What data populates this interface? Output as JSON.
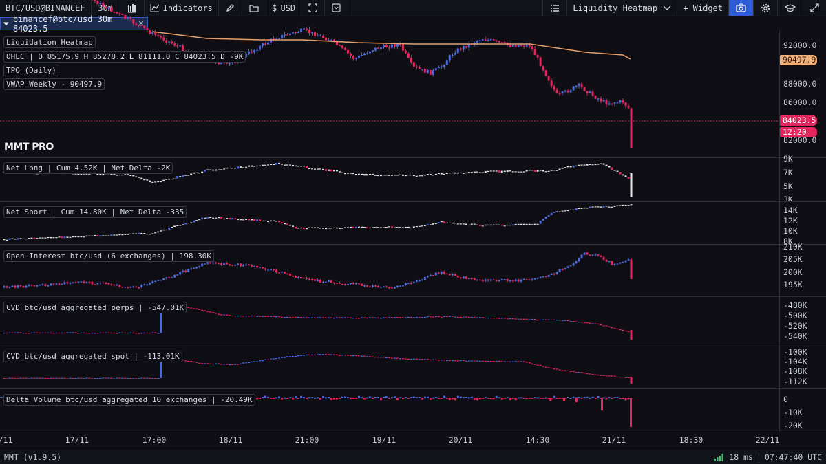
{
  "toolbar": {
    "symbol": "BTC/USD@BINANCEF",
    "interval": "30m",
    "indicators_label": "Indicators",
    "currency_label": "USD",
    "layout_name": "Liquidity Heatmap",
    "widget_label": "+ Widget"
  },
  "tab": {
    "label": "binancef@btc/usd 30m 84023.5",
    "close_icon": "×"
  },
  "brand": "MMT PRO",
  "legends": {
    "heatmap": "Liquidation Heatmap",
    "ohlc": "OHLC | O 85175.9 H 85278.2 L 81111.0 C 84023.5 D -9K",
    "tpo": "TPO (Daily)",
    "vwap": "VWAP Weekly - 90497.9",
    "net_long": "Net Long | Cum 4.52K | Net Delta -2K",
    "net_short": "Net Short | Cum 14.80K | Net Delta -335",
    "oi": "Open Interest btc/usd (6 exchanges) | 198.30K",
    "cvd_perps": "CVD btc/usd aggregated perps | -547.01K",
    "cvd_spot": "CVD btc/usd aggregated spot | -113.01K",
    "delta_vol": "Delta Volume btc/usd aggregated 10 exchanges | -20.49K"
  },
  "yaxis": {
    "price": [
      "92000.0",
      "88000.0",
      "86000.0",
      "82000.0"
    ],
    "vwap_tag": "90497.9",
    "price_tag": "84023.5",
    "countdown_tag": "12:20",
    "net_long": [
      "9K",
      "7K",
      "5K",
      "3K"
    ],
    "net_short": [
      "14K",
      "12K",
      "10K",
      "8K"
    ],
    "oi": [
      "210K",
      "205K",
      "200K",
      "195K"
    ],
    "cvd_perps": [
      "-480K",
      "-500K",
      "-520K",
      "-540K"
    ],
    "cvd_spot": [
      "-100K",
      "-104K",
      "-108K",
      "-112K"
    ],
    "delta_vol": [
      "0",
      "-10K",
      "-20K"
    ]
  },
  "xaxis": [
    "/11",
    "17/11",
    "17:00",
    "18/11",
    "21:00",
    "19/11",
    "20/11",
    "14:30",
    "21/11",
    "18:30",
    "22/11"
  ],
  "status": {
    "version": "MMT (v1.9.5)",
    "latency": "18 ms",
    "clock": "07:47:40 UTC"
  },
  "colors": {
    "up": "#4f6bd8",
    "down": "#e0285e",
    "vwap": "#e8a06a",
    "accent": "#2e5bd6",
    "price_tag": "#e0285e",
    "vwap_tag": "#f0b07c",
    "doji": "#e8e8ec",
    "signal": "#3fbf6f"
  },
  "icons": [
    "candles-icon",
    "indicators-icon",
    "pencil-icon",
    "folder-icon",
    "dollar-icon",
    "fullscreen-icon",
    "save-icon",
    "list-icon",
    "chevron-down-icon",
    "camera-icon",
    "gear-icon",
    "graduation-cap-icon",
    "expand-icon",
    "signal-icon",
    "close-icon"
  ]
}
